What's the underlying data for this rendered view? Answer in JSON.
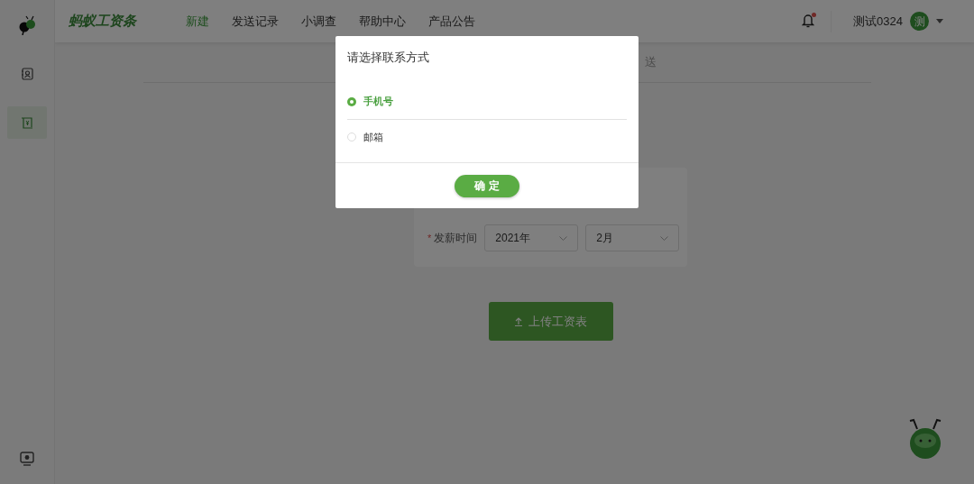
{
  "sidebar": {
    "items": [
      {
        "kind": "contacts",
        "selected": false
      },
      {
        "kind": "payslip",
        "selected": true
      }
    ]
  },
  "header": {
    "logo": "蚂蚁工资条",
    "nav": [
      {
        "label": "新建",
        "selected": true
      },
      {
        "label": "发送记录",
        "selected": false
      },
      {
        "label": "小调查",
        "selected": false
      },
      {
        "label": "帮助中心",
        "selected": false
      },
      {
        "label": "产品公告",
        "selected": false
      }
    ],
    "notification": {
      "unread": true
    },
    "user": "测试0324",
    "avatar": "测"
  },
  "page": {
    "step_label": "送",
    "form": {
      "label": "发薪时间",
      "required_mark": "*",
      "selects": [
        "2021年",
        "2月"
      ]
    },
    "upload_button": "上传工资表"
  },
  "dialog": {
    "title": "请选择联系方式",
    "options": [
      {
        "label": "手机号",
        "selected": true
      },
      {
        "label": "邮箱",
        "selected": false
      }
    ],
    "confirm": "确 定"
  }
}
